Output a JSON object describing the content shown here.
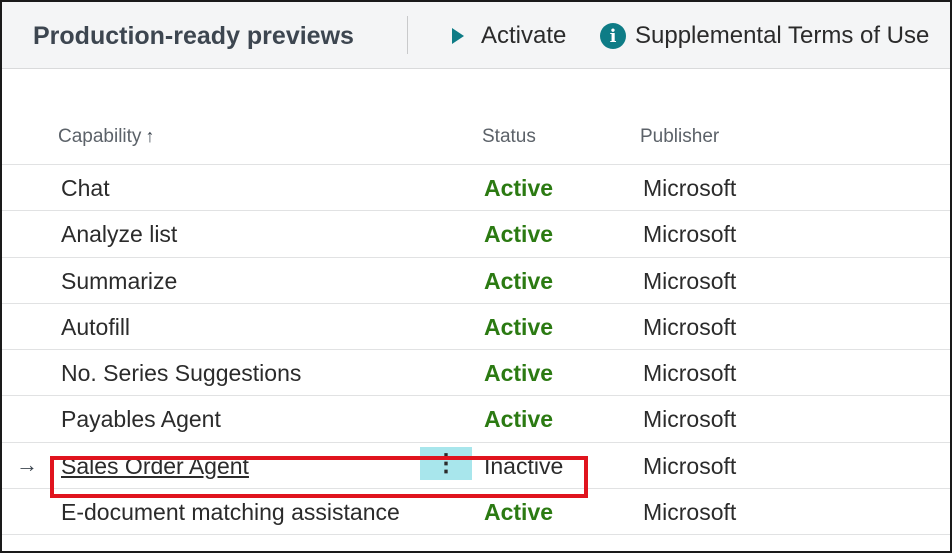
{
  "toolbar": {
    "title": "Production-ready previews",
    "activate_label": "Activate",
    "terms_label": "Supplemental Terms of Use",
    "activate_icon": "play-icon",
    "terms_icon": "info-icon",
    "info_glyph": "i"
  },
  "grid": {
    "columns": {
      "capability": "Capability",
      "capability_sort": "↑",
      "status": "Status",
      "publisher": "Publisher"
    },
    "rows": [
      {
        "capability": "Chat",
        "status": "Active",
        "publisher": "Microsoft"
      },
      {
        "capability": "Analyze list",
        "status": "Active",
        "publisher": "Microsoft"
      },
      {
        "capability": "Summarize",
        "status": "Active",
        "publisher": "Microsoft"
      },
      {
        "capability": "Autofill",
        "status": "Active",
        "publisher": "Microsoft"
      },
      {
        "capability": "No. Series Suggestions",
        "status": "Active",
        "publisher": "Microsoft"
      },
      {
        "capability": "Payables Agent",
        "status": "Active",
        "publisher": "Microsoft"
      },
      {
        "capability": "Sales Order Agent",
        "status": "Inactive",
        "publisher": "Microsoft",
        "selected": true,
        "row_marker": "→",
        "more_glyph": "⋮"
      },
      {
        "capability": "E-document matching assistance",
        "status": "Active",
        "publisher": "Microsoft"
      }
    ]
  },
  "colors": {
    "active_status": "#2b7a12",
    "accent": "#0e7c86",
    "highlight": "#e0141e",
    "more_button_bg": "#a8e6ec"
  }
}
